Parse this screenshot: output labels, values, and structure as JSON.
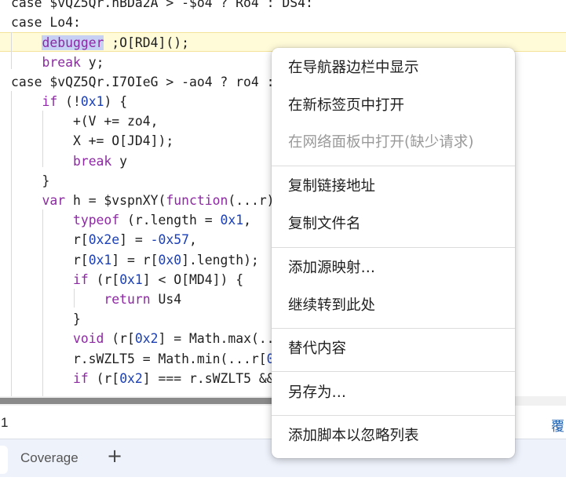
{
  "colors": {
    "keyword": "#8d2aa3",
    "number": "#1a3fb6",
    "text": "#1f1f1f",
    "line_highlight": "#fffbd9",
    "selection": "#c6d0f5",
    "drawer_background": "#eef2fb",
    "status_link": "#1a5fb4"
  },
  "editor": {
    "lines": [
      {
        "tokens": [
          {
            "t": "case $vQZ5Qr.hBDa2A > -$o4 ? Ro4 : DS4:",
            "c": "plain"
          }
        ]
      },
      {
        "tokens": [
          {
            "t": "case Lo4:",
            "c": "plain"
          }
        ]
      },
      {
        "tokens": [
          {
            "t": "    ",
            "c": "plain"
          },
          {
            "t": "debugger",
            "c": "kwsel"
          },
          {
            "t": " ;O[RD4]();",
            "c": "plain"
          }
        ],
        "highlight": true
      },
      {
        "tokens": [
          {
            "t": "    ",
            "c": "plain"
          },
          {
            "t": "break",
            "c": "kw"
          },
          {
            "t": " y;",
            "c": "plain"
          }
        ]
      },
      {
        "tokens": [
          {
            "t": "case $vQZ5Qr.I7OIeG > -ao4 ? ro4 :",
            "c": "plain"
          }
        ]
      },
      {
        "tokens": [
          {
            "t": "    ",
            "c": "plain"
          },
          {
            "t": "if",
            "c": "kw"
          },
          {
            "t": " (!",
            "c": "plain"
          },
          {
            "t": "0x1",
            "c": "num"
          },
          {
            "t": ") {",
            "c": "plain"
          }
        ]
      },
      {
        "tokens": [
          {
            "t": "        +(V += zo4,",
            "c": "plain"
          }
        ]
      },
      {
        "tokens": [
          {
            "t": "        X += O[JD4]);",
            "c": "plain"
          }
        ]
      },
      {
        "tokens": [
          {
            "t": "        ",
            "c": "plain"
          },
          {
            "t": "break",
            "c": "kw"
          },
          {
            "t": " y",
            "c": "plain"
          }
        ]
      },
      {
        "tokens": [
          {
            "t": "    }",
            "c": "plain"
          }
        ]
      },
      {
        "tokens": [
          {
            "t": "    ",
            "c": "plain"
          },
          {
            "t": "var",
            "c": "kw"
          },
          {
            "t": " h = $vspnXY(",
            "c": "plain"
          },
          {
            "t": "function",
            "c": "kw"
          },
          {
            "t": "(...r)",
            "c": "plain"
          }
        ]
      },
      {
        "tokens": [
          {
            "t": "        ",
            "c": "plain"
          },
          {
            "t": "typeof",
            "c": "kw"
          },
          {
            "t": " (r.length = ",
            "c": "plain"
          },
          {
            "t": "0x1",
            "c": "num"
          },
          {
            "t": ",",
            "c": "plain"
          }
        ]
      },
      {
        "tokens": [
          {
            "t": "        r[",
            "c": "plain"
          },
          {
            "t": "0x2e",
            "c": "num"
          },
          {
            "t": "] = ",
            "c": "plain"
          },
          {
            "t": "-0x57",
            "c": "num"
          },
          {
            "t": ",",
            "c": "plain"
          }
        ]
      },
      {
        "tokens": [
          {
            "t": "        r[",
            "c": "plain"
          },
          {
            "t": "0x1",
            "c": "num"
          },
          {
            "t": "] = r[",
            "c": "plain"
          },
          {
            "t": "0x0",
            "c": "num"
          },
          {
            "t": "].length);",
            "c": "plain"
          }
        ]
      },
      {
        "tokens": [
          {
            "t": "        ",
            "c": "plain"
          },
          {
            "t": "if",
            "c": "kw"
          },
          {
            "t": " (r[",
            "c": "plain"
          },
          {
            "t": "0x1",
            "c": "num"
          },
          {
            "t": "] < O[MD4]) {",
            "c": "plain"
          }
        ]
      },
      {
        "tokens": [
          {
            "t": "            ",
            "c": "plain"
          },
          {
            "t": "return",
            "c": "kw"
          },
          {
            "t": " Us4",
            "c": "plain"
          }
        ]
      },
      {
        "tokens": [
          {
            "t": "        }",
            "c": "plain"
          }
        ]
      },
      {
        "tokens": [
          {
            "t": "        ",
            "c": "plain"
          },
          {
            "t": "void",
            "c": "kw"
          },
          {
            "t": " (r[",
            "c": "plain"
          },
          {
            "t": "0x2",
            "c": "num"
          },
          {
            "t": "] = Math.max(..",
            "c": "plain"
          }
        ]
      },
      {
        "tokens": [
          {
            "t": "        r.sWZLT5 = Math.min(...r[",
            "c": "plain"
          },
          {
            "t": "0",
            "c": "num"
          }
        ]
      },
      {
        "tokens": [
          {
            "t": "        ",
            "c": "plain"
          },
          {
            "t": "if",
            "c": "kw"
          },
          {
            "t": " (r[",
            "c": "plain"
          },
          {
            "t": "0x2",
            "c": "num"
          },
          {
            "t": "] === r.sWZLT5 &&",
            "c": "plain"
          }
        ]
      }
    ]
  },
  "status_bar": {
    "left_text": "1",
    "right_text": "覆"
  },
  "drawer": {
    "tab_coverage": "Coverage",
    "add_tab": "+"
  },
  "context_menu": {
    "items": [
      {
        "label": "在导航器边栏中显示",
        "disabled": false,
        "name": "menu-item-reveal-in-navigator"
      },
      {
        "label": "在新标签页中打开",
        "disabled": false,
        "name": "menu-item-open-in-new-tab"
      },
      {
        "label": "在网络面板中打开(缺少请求)",
        "disabled": true,
        "name": "menu-item-open-in-network-panel"
      },
      {
        "label": "复制链接地址",
        "disabled": false,
        "name": "menu-item-copy-link-address"
      },
      {
        "label": "复制文件名",
        "disabled": false,
        "name": "menu-item-copy-file-name"
      },
      {
        "label": "添加源映射…",
        "disabled": false,
        "name": "menu-item-add-source-map"
      },
      {
        "label": "继续转到此处",
        "disabled": false,
        "name": "menu-item-continue-to-here"
      },
      {
        "label": "替代内容",
        "disabled": false,
        "name": "menu-item-override-content"
      },
      {
        "label": "另存为…",
        "disabled": false,
        "name": "menu-item-save-as"
      },
      {
        "label": "添加脚本以忽略列表",
        "disabled": false,
        "name": "menu-item-add-script-to-ignore-list"
      }
    ]
  }
}
